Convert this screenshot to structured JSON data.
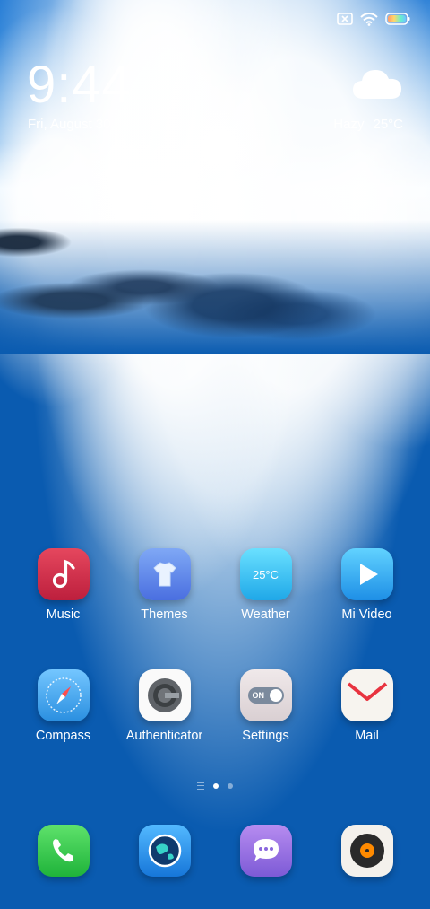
{
  "status_bar": {
    "icons": [
      "sim-x-icon",
      "wifi-icon",
      "battery-icon"
    ]
  },
  "clock_widget": {
    "time": "9:44",
    "date": "Fri, August 30"
  },
  "weather_widget": {
    "icon": "cloud-icon",
    "condition": "Hazy",
    "temperature": "25°C"
  },
  "apps": [
    {
      "label": "Music",
      "icon": "music-icon"
    },
    {
      "label": "Themes",
      "icon": "themes-icon"
    },
    {
      "label": "Weather",
      "icon": "weather-icon",
      "icon_text": "25°C"
    },
    {
      "label": "Mi Video",
      "icon": "mi-video-icon"
    },
    {
      "label": "Compass",
      "icon": "compass-icon"
    },
    {
      "label": "Authenticator",
      "icon": "authenticator-icon"
    },
    {
      "label": "Settings",
      "icon": "settings-icon",
      "icon_text": "ON"
    },
    {
      "label": "Mail",
      "icon": "mail-icon"
    }
  ],
  "page_indicator": {
    "pages": 2,
    "current": 1
  },
  "dock": [
    {
      "icon": "phone-icon"
    },
    {
      "icon": "browser-icon"
    },
    {
      "icon": "messages-icon"
    },
    {
      "icon": "music-player-icon"
    }
  ]
}
